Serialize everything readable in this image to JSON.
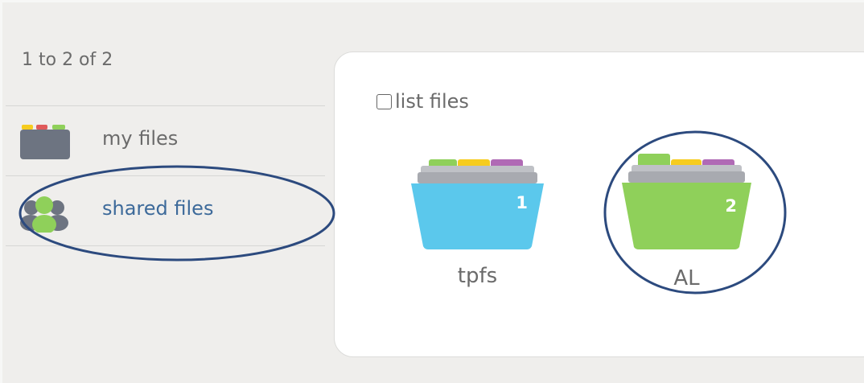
{
  "header": {
    "count_text": "1 to 2 of 2"
  },
  "sidebar": {
    "items": [
      {
        "label": "my files",
        "icon": "folder-stack-icon",
        "active": false
      },
      {
        "label": "shared files",
        "icon": "people-icon",
        "active": true
      }
    ]
  },
  "main": {
    "list_files_label": "list files",
    "list_files_checked": false,
    "folders": [
      {
        "name": "tpfs",
        "count": "1",
        "color": "#5bc8ec"
      },
      {
        "name": "AL",
        "count": "2",
        "color": "#8fd05a"
      }
    ]
  },
  "colors": {
    "annotation": "#2c4a7e",
    "tab_green": "#8fd05a",
    "tab_yellow": "#f6cc1e",
    "tab_purple": "#b06ab5",
    "folder_gray": "#a8aab0"
  }
}
